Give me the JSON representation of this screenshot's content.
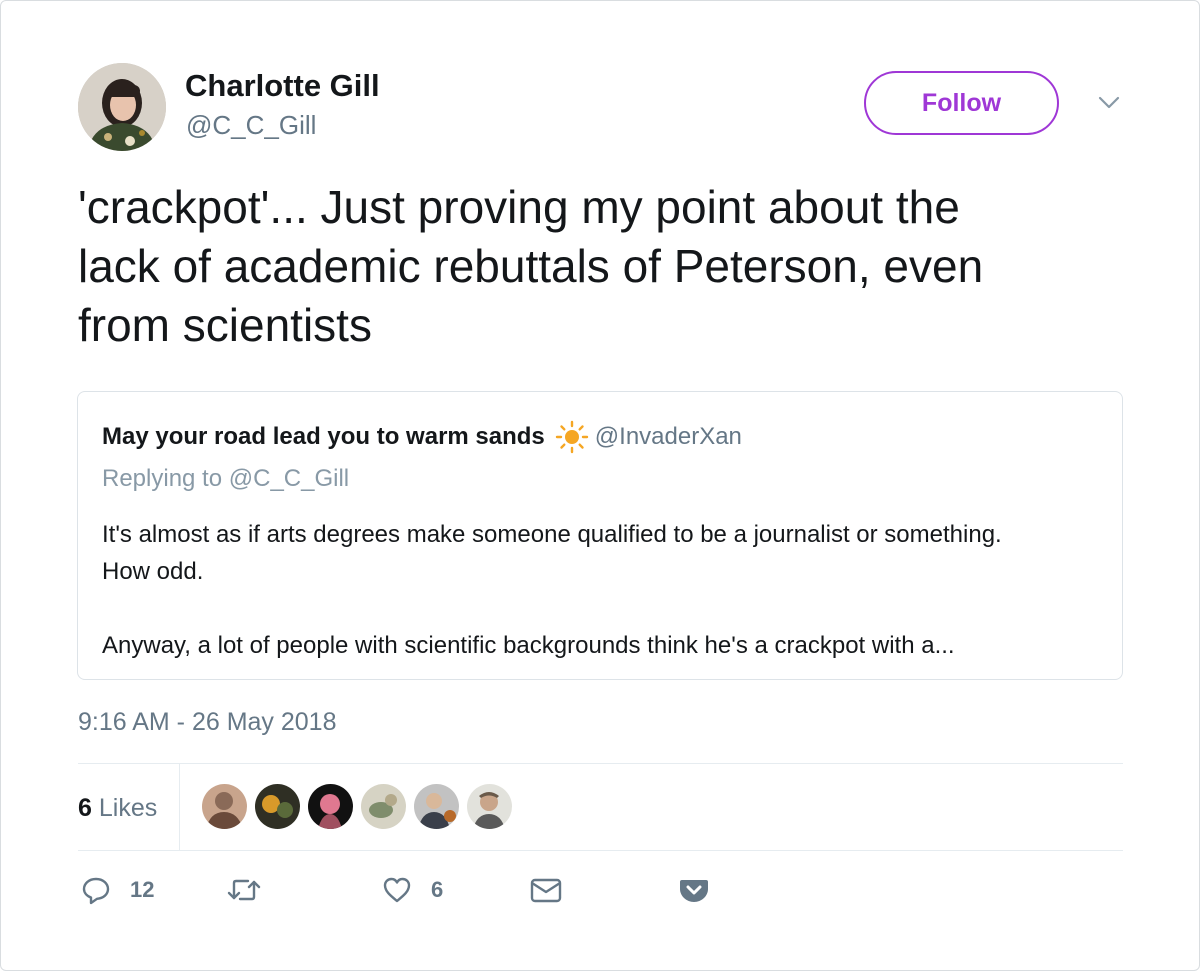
{
  "author": {
    "display_name": "Charlotte Gill",
    "handle": "@C_C_Gill"
  },
  "follow_label": "Follow",
  "tweet_text_lines": [
    "'crackpot'... Just proving my point about the",
    "lack of academic rebuttals of Peterson, even",
    "from scientists"
  ],
  "quoted": {
    "display_name": "May your road lead you to warm sands",
    "emoji": "sun",
    "handle": "@InvaderXan",
    "replying_prefix": "Replying to",
    "replying_handle": "@C_C_Gill",
    "body_lines": [
      "It's almost as if arts degrees make someone qualified to be a journalist or something.",
      "How odd.",
      "",
      "Anyway, a lot of people with scientific backgrounds think he's a crackpot with a..."
    ]
  },
  "timestamp": "9:16 AM - 26 May 2018",
  "stats": {
    "likes_count": "6",
    "likes_label": "Likes"
  },
  "likers": [
    {
      "name": "liker-1",
      "colors": [
        "#8a6a58",
        "#c8a48c"
      ]
    },
    {
      "name": "liker-2",
      "colors": [
        "#3a3a2a",
        "#d89a2a"
      ]
    },
    {
      "name": "liker-3",
      "colors": [
        "#111111",
        "#e07890"
      ]
    },
    {
      "name": "liker-4",
      "colors": [
        "#c9c6b8",
        "#7f8d6c"
      ]
    },
    {
      "name": "liker-5",
      "colors": [
        "#b7b7b7",
        "#3a3f4a"
      ]
    },
    {
      "name": "liker-6",
      "colors": [
        "#d8d8d2",
        "#6a5a4a"
      ]
    }
  ],
  "actions": {
    "reply_count": "12",
    "retweet_count": "",
    "like_count": "6"
  },
  "colors": {
    "accent_purple": "#9f37d6",
    "text_primary": "#14171a",
    "text_secondary": "#657786",
    "sun_orange": "#f5a623",
    "border": "#e6ecf0"
  }
}
